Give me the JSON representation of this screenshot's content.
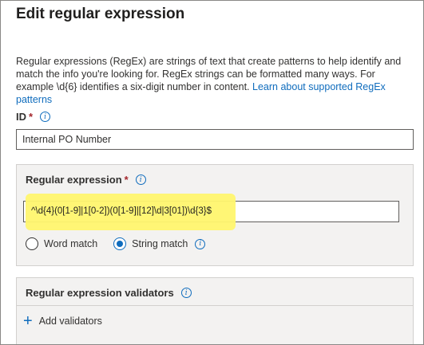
{
  "dialog": {
    "title": "Edit regular expression",
    "description": "Regular expressions (RegEx) are strings of text that create patterns to help identify and match the info you're looking for. RegEx strings can be formatted many ways. For example \\d{6} identifies a six-digit number in content.",
    "learn_link": "Learn about supported RegEx patterns"
  },
  "id_field": {
    "label": "ID",
    "required_mark": "*",
    "value": "Internal PO Number"
  },
  "regex_section": {
    "label": "Regular expression",
    "required_mark": "*",
    "value": "^\\d{4}(0[1-9]|1[0-2])(0[1-9]|[12]\\d|3[01])\\d{3}$",
    "highlight_color": "#fff66e",
    "options": [
      {
        "label": "Word match",
        "selected": false
      },
      {
        "label": "String match",
        "selected": true
      }
    ]
  },
  "validators_section": {
    "label": "Regular expression validators",
    "add_label": "Add validators"
  },
  "colors": {
    "accent": "#0f6cbd",
    "required": "#a4262c",
    "panel_bg": "#f3f2f1"
  }
}
